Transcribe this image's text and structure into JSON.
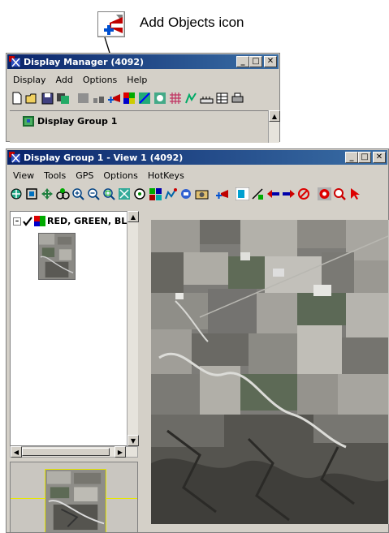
{
  "callout": {
    "label": "Add Objects icon"
  },
  "display_manager": {
    "title": "Display Manager (4092)",
    "menu": [
      "Display",
      "Add",
      "Options",
      "Help"
    ],
    "group_label": "Display Group 1",
    "toolbar_icons": [
      "new-icon",
      "open-icon",
      "save-icon",
      "clone-icon",
      "gray-layer-icon",
      "edit-icon",
      "add-objects-icon",
      "rgb-layer-icon",
      "vector-icon",
      "annotation-icon",
      "grid-icon",
      "chart-icon",
      "ruler-icon",
      "table-icon",
      "print-icon"
    ]
  },
  "display_view": {
    "title": "Display Group 1 - View 1 (4092)",
    "menu": [
      "View",
      "Tools",
      "GPS",
      "Options",
      "HotKeys"
    ],
    "layer_label": "RED, GREEN, BLU",
    "toolbar_icons": [
      "pan-icon",
      "fit-icon",
      "move-icon",
      "overview-icon",
      "zoom-in-icon",
      "zoom-out-icon",
      "zoom-box-icon",
      "zoom-full-icon",
      "gps-icon",
      "swipe-icon",
      "profile-icon",
      "measure-icon",
      "snapshot-icon",
      "add-objects-icon",
      "cursor-info-icon",
      "link-icon",
      "back-icon",
      "forward-icon",
      "clear-icon",
      "record-icon",
      "magnify-icon",
      "select-icon"
    ]
  },
  "colors": {
    "titlebar": "#0a246a",
    "window": "#d4d0c8",
    "overview_frame": "#e8e800"
  }
}
